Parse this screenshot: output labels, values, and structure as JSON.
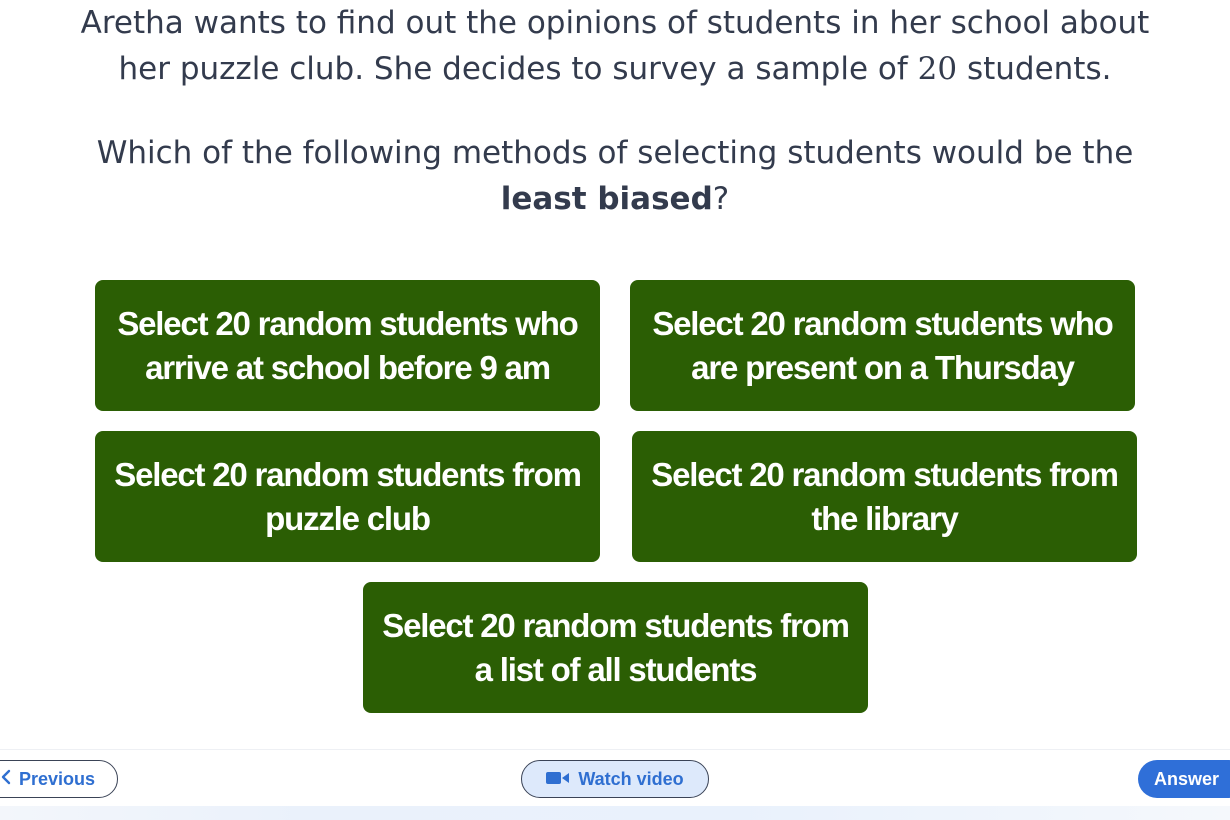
{
  "question": {
    "line1": "Aretha wants to find out the opinions of students in her school about",
    "line2_before": "her puzzle club. She decides to survey a sample of ",
    "line2_number": "20",
    "line2_after": " students.",
    "prompt_line1": "Which of the following methods of selecting students would be the",
    "prompt_bold": "least biased",
    "prompt_end": "?"
  },
  "options": [
    {
      "line1": "Select 20 random students who",
      "line2": "arrive at school before 9 am"
    },
    {
      "line1": "Select 20 random students who",
      "line2": "are present on a Thursday"
    },
    {
      "line1": "Select 20 random students from",
      "line2": "puzzle club"
    },
    {
      "line1": "Select 20 random students from",
      "line2": "the library"
    },
    {
      "line1": "Select 20 random students from",
      "line2": "a list of all students"
    }
  ],
  "toolbar": {
    "previous_label": "Previous",
    "watch_video_label": "Watch video",
    "answer_label": "Answer",
    "previous_icon": "chevron-left-icon",
    "video_icon": "video-camera-icon"
  },
  "colors": {
    "option_bg": "#2b5e04",
    "text": "#333b4d",
    "link_blue": "#2f6fd1",
    "answer_bg": "#2f6fd8",
    "watch_bg": "#dde9fb"
  }
}
